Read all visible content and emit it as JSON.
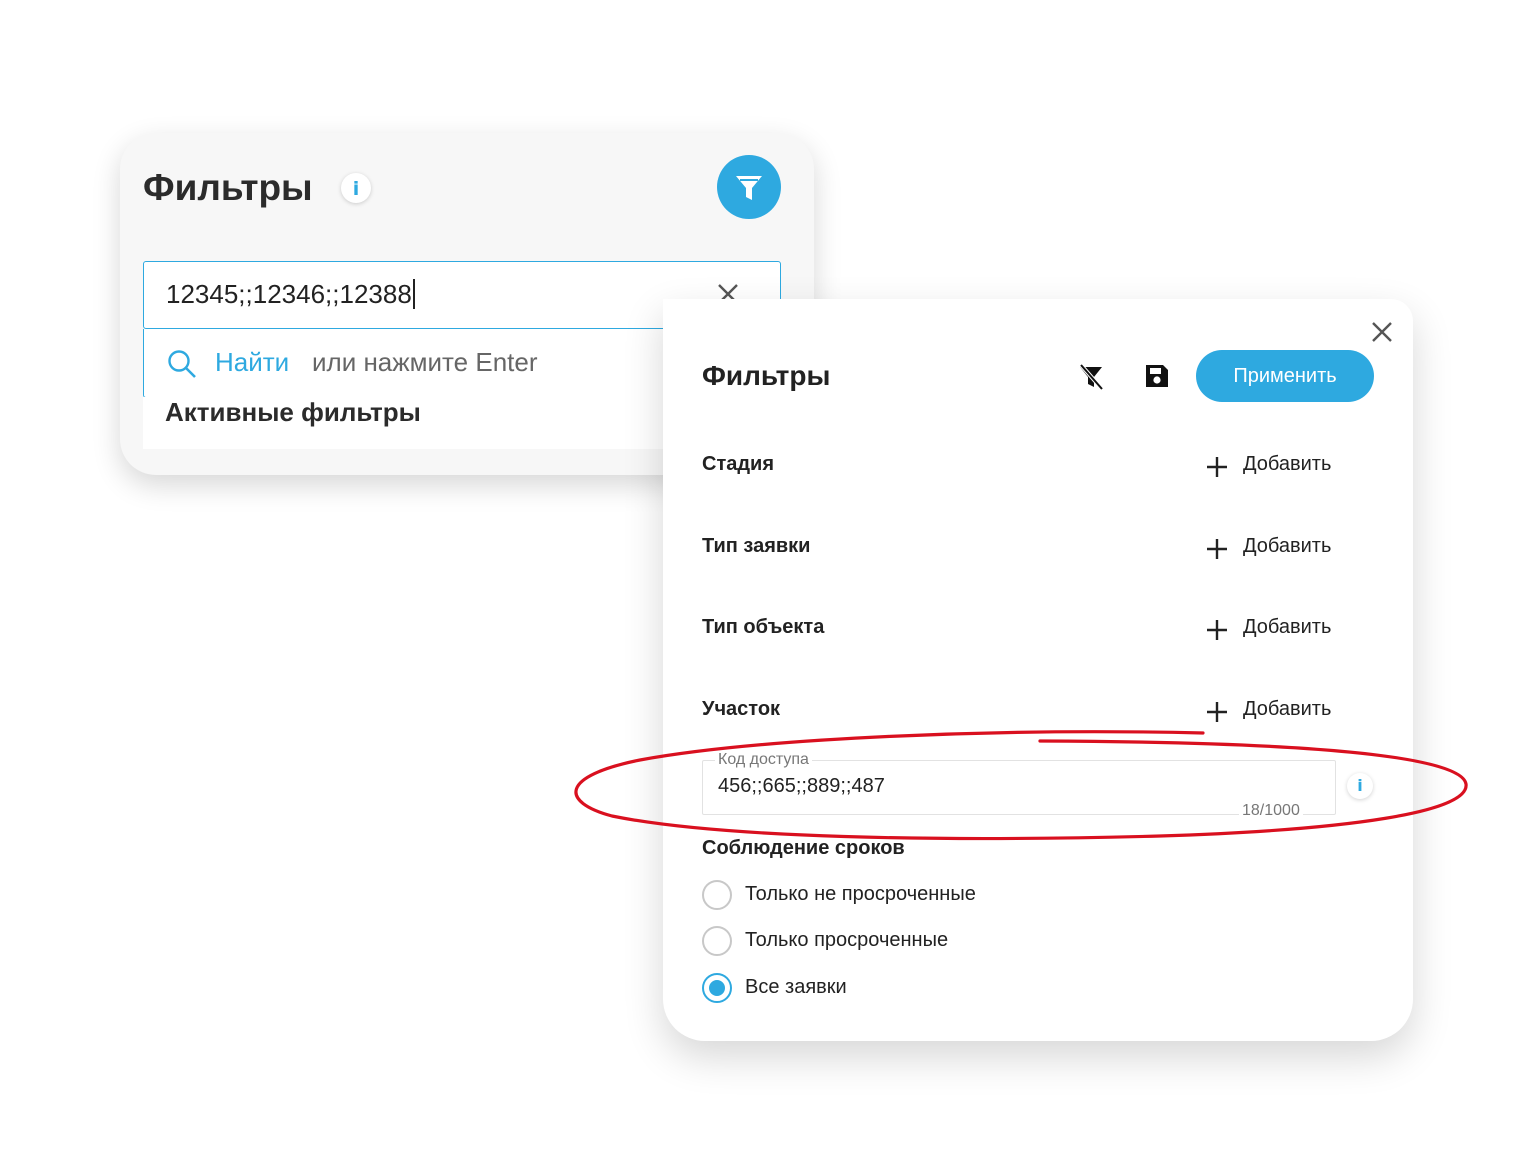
{
  "colors": {
    "accent": "#2ea9e0",
    "annotation": "#d9101f"
  },
  "search_panel": {
    "title": "Фильтры",
    "info_icon": "info-icon",
    "filter_button_icon": "funnel-icon",
    "search_value": "12345;;12346;;12388",
    "clear_icon": "close-icon",
    "suggest_icon": "search-icon",
    "suggest_action": "Найти",
    "suggest_hint": "или нажмите Enter",
    "active_filters_label": "Активные фильтры"
  },
  "filters_dialog": {
    "title": "Фильтры",
    "close_icon": "close-icon",
    "clear_filters_icon": "filter-off-icon",
    "save_icon": "floppy-disk-icon",
    "apply_label": "Применить",
    "rows": [
      {
        "label": "Стадия",
        "add_label": "Добавить"
      },
      {
        "label": "Тип заявки",
        "add_label": "Добавить"
      },
      {
        "label": "Тип объекта",
        "add_label": "Добавить"
      },
      {
        "label": "Участок",
        "add_label": "Добавить"
      }
    ],
    "access_code": {
      "label": "Код доступа",
      "value": "456;;665;;889;;487",
      "counter": "18/1000"
    },
    "deadline": {
      "label": "Соблюдение сроков",
      "options": [
        {
          "label": "Только не просроченные",
          "checked": false
        },
        {
          "label": "Только просроченные",
          "checked": false
        },
        {
          "label": "Все заявки",
          "checked": true
        }
      ]
    }
  }
}
